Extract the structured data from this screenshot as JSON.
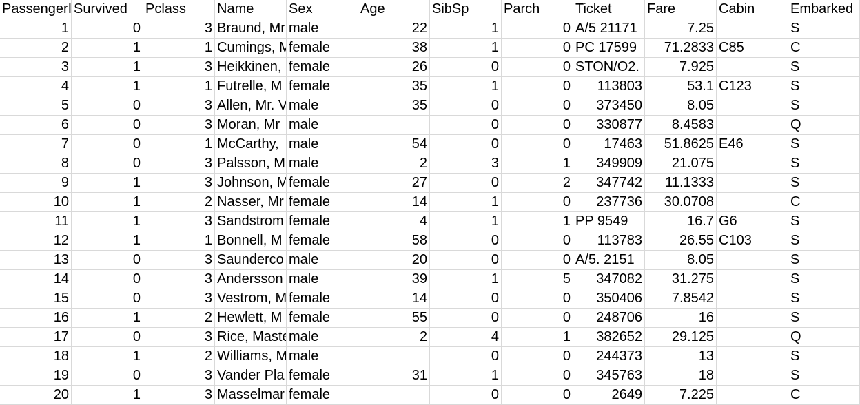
{
  "sheet": {
    "headers": [
      "PassengerI",
      "Survived",
      "Pclass",
      "Name",
      "Sex",
      "Age",
      "SibSp",
      "Parch",
      "Ticket",
      "Fare",
      "Cabin",
      "Embarked"
    ],
    "rows": [
      [
        "1",
        "0",
        "3",
        "Braund, Mr",
        "male",
        "22",
        "1",
        "0",
        "A/5 21171",
        "7.25",
        "",
        "S"
      ],
      [
        "2",
        "1",
        "1",
        "Cumings, M",
        "female",
        "38",
        "1",
        "0",
        "PC 17599",
        "71.2833",
        "C85",
        "C"
      ],
      [
        "3",
        "1",
        "3",
        "Heikkinen,",
        "female",
        "26",
        "0",
        "0",
        "STON/O2.",
        "7.925",
        "",
        "S"
      ],
      [
        "4",
        "1",
        "1",
        "Futrelle, M",
        "female",
        "35",
        "1",
        "0",
        "113803",
        "53.1",
        "C123",
        "S"
      ],
      [
        "5",
        "0",
        "3",
        "Allen, Mr. V",
        "male",
        "35",
        "0",
        "0",
        "373450",
        "8.05",
        "",
        "S"
      ],
      [
        "6",
        "0",
        "3",
        "Moran, Mr",
        "male",
        "",
        "0",
        "0",
        "330877",
        "8.4583",
        "",
        "Q"
      ],
      [
        "7",
        "0",
        "1",
        "McCarthy,",
        "male",
        "54",
        "0",
        "0",
        "17463",
        "51.8625",
        "E46",
        "S"
      ],
      [
        "8",
        "0",
        "3",
        "Palsson, M",
        "male",
        "2",
        "3",
        "1",
        "349909",
        "21.075",
        "",
        "S"
      ],
      [
        "9",
        "1",
        "3",
        "Johnson, M",
        "female",
        "27",
        "0",
        "2",
        "347742",
        "11.1333",
        "",
        "S"
      ],
      [
        "10",
        "1",
        "2",
        "Nasser, Mr",
        "female",
        "14",
        "1",
        "0",
        "237736",
        "30.0708",
        "",
        "C"
      ],
      [
        "11",
        "1",
        "3",
        "Sandstrom",
        "female",
        "4",
        "1",
        "1",
        "PP 9549",
        "16.7",
        "G6",
        "S"
      ],
      [
        "12",
        "1",
        "1",
        "Bonnell, M",
        "female",
        "58",
        "0",
        "0",
        "113783",
        "26.55",
        "C103",
        "S"
      ],
      [
        "13",
        "0",
        "3",
        "Saunderco",
        "male",
        "20",
        "0",
        "0",
        "A/5. 2151",
        "8.05",
        "",
        "S"
      ],
      [
        "14",
        "0",
        "3",
        "Andersson",
        "male",
        "39",
        "1",
        "5",
        "347082",
        "31.275",
        "",
        "S"
      ],
      [
        "15",
        "0",
        "3",
        "Vestrom, M",
        "female",
        "14",
        "0",
        "0",
        "350406",
        "7.8542",
        "",
        "S"
      ],
      [
        "16",
        "1",
        "2",
        "Hewlett, M",
        "female",
        "55",
        "0",
        "0",
        "248706",
        "16",
        "",
        "S"
      ],
      [
        "17",
        "0",
        "3",
        "Rice, Maste",
        "male",
        "2",
        "4",
        "1",
        "382652",
        "29.125",
        "",
        "Q"
      ],
      [
        "18",
        "1",
        "2",
        "Williams, M",
        "male",
        "",
        "0",
        "0",
        "244373",
        "13",
        "",
        "S"
      ],
      [
        "19",
        "0",
        "3",
        "Vander Pla",
        "female",
        "31",
        "1",
        "0",
        "345763",
        "18",
        "",
        "S"
      ],
      [
        "20",
        "1",
        "3",
        "Masselmar",
        "female",
        "",
        "0",
        "0",
        "2649",
        "7.225",
        "",
        "C"
      ]
    ]
  }
}
